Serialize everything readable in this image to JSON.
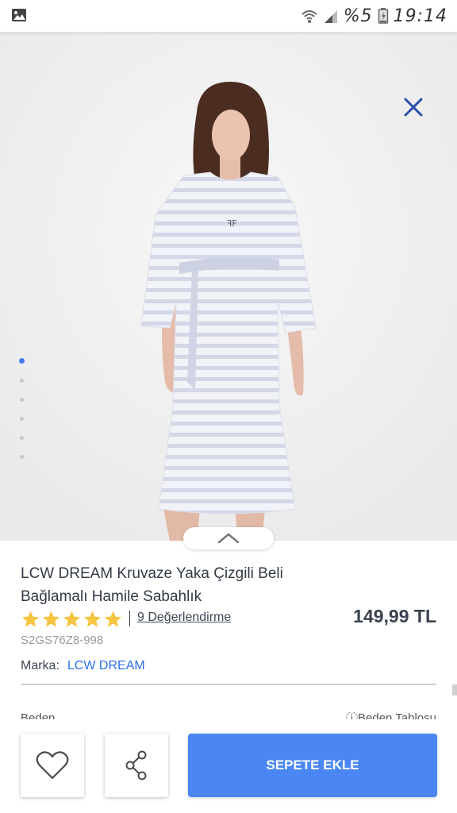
{
  "status_bar": {
    "time": "19:14",
    "battery_text": "%5"
  },
  "gallery": {
    "dot_count": 6,
    "active_index": 0
  },
  "product": {
    "title_line1": "LCW DREAM Kruvaze Yaka Çizgili Beli",
    "title_line2": "Bağlamalı Hamile Sabahlık",
    "rating": 5,
    "reviews_text": "9 Değerlendirme",
    "price": "149,99 TL",
    "sku": "S2GS76Z8-998",
    "brand_label": "Marka:",
    "brand_value": "LCW DREAM"
  },
  "partial_section": {
    "left": "Beden",
    "right": "Beden Tablosu"
  },
  "actions": {
    "add_to_cart_label": "SEPETE EKLE"
  },
  "colors": {
    "accent": "#4a86f4",
    "link": "#2d6ee8",
    "star": "#f7c442",
    "close": "#2b4fa8"
  }
}
